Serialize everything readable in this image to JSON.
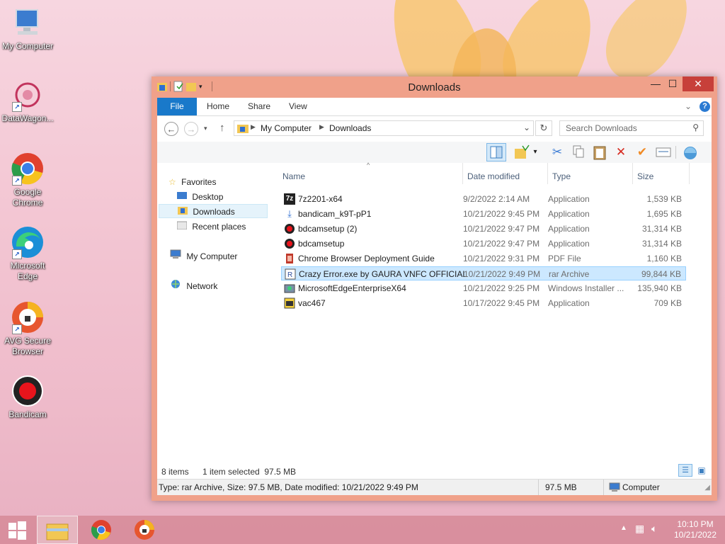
{
  "desktop": {
    "icons": [
      {
        "label": "My Computer"
      },
      {
        "label": "DataWagon..."
      },
      {
        "label": "Google Chrome"
      },
      {
        "label": "Microsoft Edge"
      },
      {
        "label": "AVG Secure Browser"
      },
      {
        "label": "Bandicam"
      }
    ]
  },
  "window": {
    "title": "Downloads",
    "controls": {
      "minimize": "—",
      "maximize": "☐",
      "close": "✕"
    }
  },
  "ribbon": {
    "tabs": [
      "File",
      "Home",
      "Share",
      "View"
    ],
    "help": "?"
  },
  "address": {
    "crumbs": [
      "My Computer",
      "Downloads"
    ],
    "search_placeholder": "Search Downloads"
  },
  "navigation": {
    "favorites": "Favorites",
    "favorites_items": [
      "Desktop",
      "Downloads",
      "Recent places"
    ],
    "computer": "My Computer",
    "network": "Network"
  },
  "columns": {
    "name": "Name",
    "date": "Date modified",
    "type": "Type",
    "size": "Size"
  },
  "files": [
    {
      "name": "7z2201-x64",
      "date": "9/2/2022 2:14 AM",
      "type": "Application",
      "size": "1,539 KB"
    },
    {
      "name": "bandicam_k9T-pP1",
      "date": "10/21/2022 9:45 PM",
      "type": "Application",
      "size": "1,695 KB"
    },
    {
      "name": "bdcamsetup (2)",
      "date": "10/21/2022 9:47 PM",
      "type": "Application",
      "size": "31,314 KB"
    },
    {
      "name": "bdcamsetup",
      "date": "10/21/2022 9:47 PM",
      "type": "Application",
      "size": "31,314 KB"
    },
    {
      "name": "Chrome Browser Deployment Guide",
      "date": "10/21/2022 9:31 PM",
      "type": "PDF File",
      "size": "1,160 KB"
    },
    {
      "name": "Crazy Error.exe by GAURA VNFC OFFICIAL",
      "date": "10/21/2022 9:49 PM",
      "type": "rar Archive",
      "size": "99,844 KB"
    },
    {
      "name": "MicrosoftEdgeEnterpriseX64",
      "date": "10/21/2022 9:25 PM",
      "type": "Windows Installer ...",
      "size": "135,940 KB"
    },
    {
      "name": "vac467",
      "date": "10/17/2022 9:45 PM",
      "type": "Application",
      "size": "709 KB"
    }
  ],
  "status": {
    "items": "8 items",
    "selected": "1 item selected  97.5 MB"
  },
  "details": {
    "text": "Type: rar Archive, Size: 97.5 MB, Date modified: 10/21/2022 9:49 PM",
    "size": "97.5 MB",
    "location": "Computer"
  },
  "taskbar": {
    "time": "10:10 PM",
    "date": "10/21/2022"
  }
}
